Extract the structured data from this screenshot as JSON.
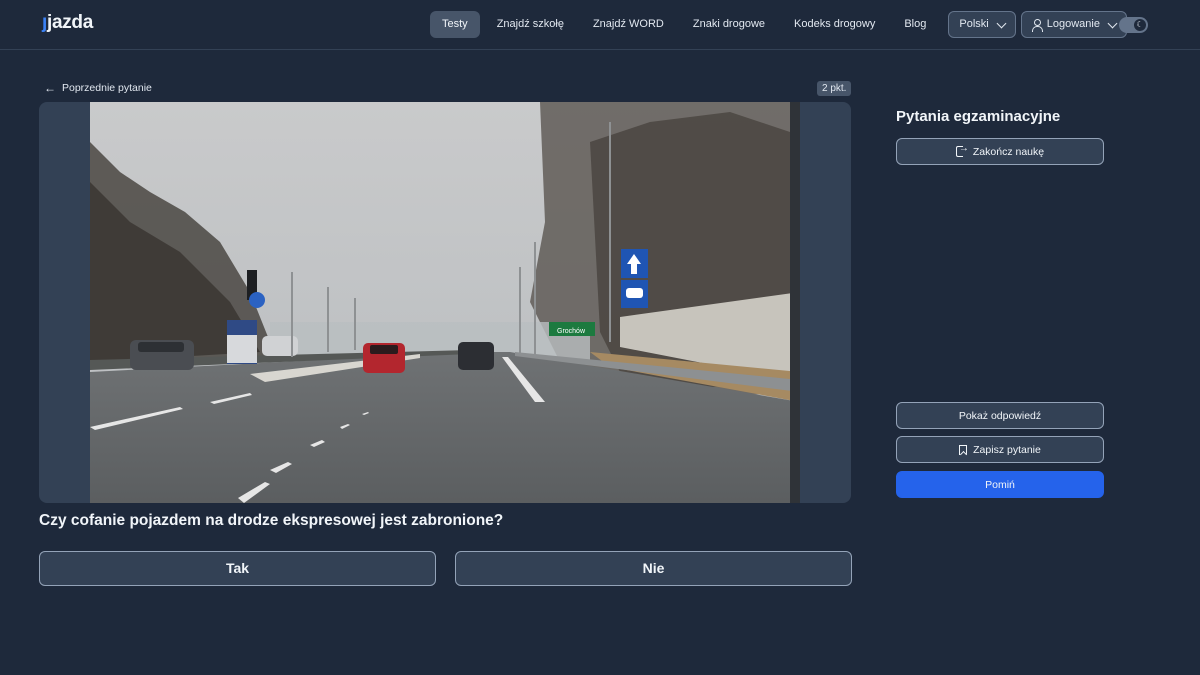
{
  "header": {
    "logo": "jazda",
    "nav": [
      "Testy",
      "Znajdź szkołę",
      "Znajdź WORD",
      "Znaki drogowe",
      "Kodeks drogowy",
      "Blog"
    ],
    "language": "Polski",
    "login": "Logowanie"
  },
  "question_view": {
    "previous_label": "Poprzednie pytanie",
    "points": "2 pkt.",
    "question_text": "Czy cofanie pojazdem na drodze ekspresowej jest zabronione?",
    "answers": [
      "Tak",
      "Nie"
    ],
    "image_signs": {
      "distance_sign": "Grochów"
    }
  },
  "side_panel": {
    "title": "Pytania egzaminacyjne",
    "end_button": "Zakończ naukę",
    "show_answer_button": "Pokaż odpowiedź",
    "save_button": "Zapisz pytanie",
    "skip_button": "Pomiń"
  },
  "colors": {
    "background": "#1e293b",
    "accent": "#2563eb",
    "logo_accent": "#3b82f6"
  }
}
